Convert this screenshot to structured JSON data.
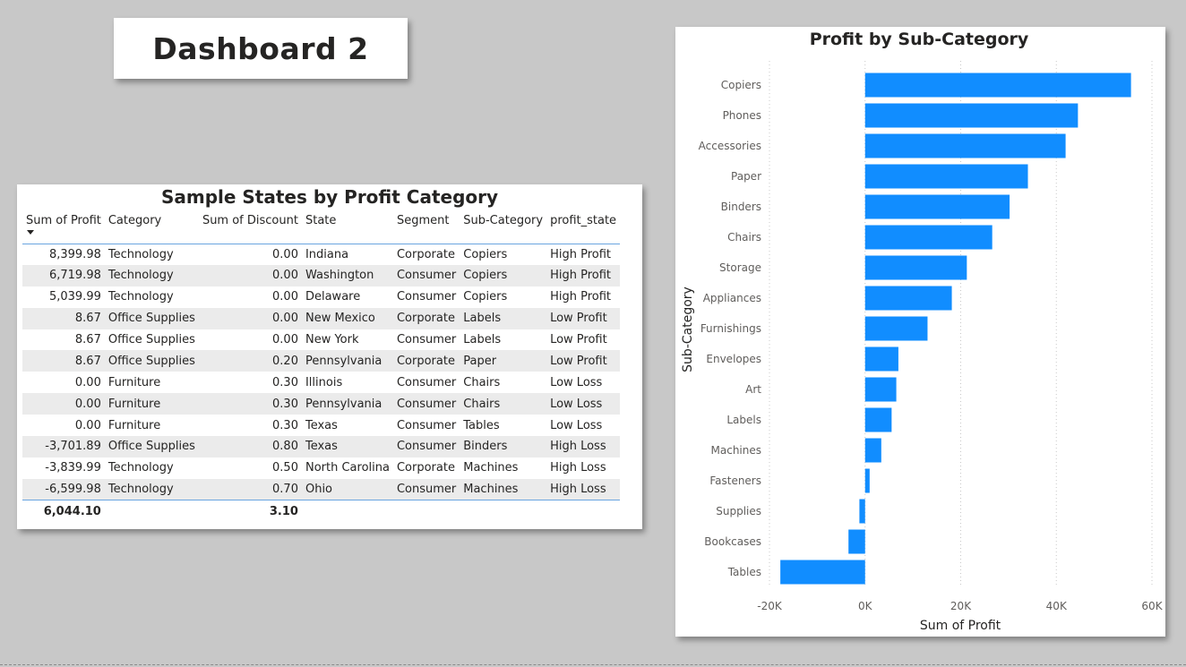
{
  "dashboard": {
    "title": "Dashboard 2"
  },
  "table": {
    "title": "Sample States by Profit Category",
    "columns": [
      "Sum of Profit",
      "Category",
      "Sum of Discount",
      "State",
      "Segment",
      "Sub-Category",
      "profit_state"
    ],
    "rows": [
      [
        "8,399.98",
        "Technology",
        "0.00",
        "Indiana",
        "Corporate",
        "Copiers",
        "High Profit"
      ],
      [
        "6,719.98",
        "Technology",
        "0.00",
        "Washington",
        "Consumer",
        "Copiers",
        "High Profit"
      ],
      [
        "5,039.99",
        "Technology",
        "0.00",
        "Delaware",
        "Consumer",
        "Copiers",
        "High Profit"
      ],
      [
        "8.67",
        "Office Supplies",
        "0.00",
        "New Mexico",
        "Corporate",
        "Labels",
        "Low Profit"
      ],
      [
        "8.67",
        "Office Supplies",
        "0.00",
        "New York",
        "Consumer",
        "Labels",
        "Low Profit"
      ],
      [
        "8.67",
        "Office Supplies",
        "0.20",
        "Pennsylvania",
        "Corporate",
        "Paper",
        "Low Profit"
      ],
      [
        "0.00",
        "Furniture",
        "0.30",
        "Illinois",
        "Consumer",
        "Chairs",
        "Low Loss"
      ],
      [
        "0.00",
        "Furniture",
        "0.30",
        "Pennsylvania",
        "Consumer",
        "Chairs",
        "Low Loss"
      ],
      [
        "0.00",
        "Furniture",
        "0.30",
        "Texas",
        "Consumer",
        "Tables",
        "Low Loss"
      ],
      [
        "-3,701.89",
        "Office Supplies",
        "0.80",
        "Texas",
        "Consumer",
        "Binders",
        "High Loss"
      ],
      [
        "-3,839.99",
        "Technology",
        "0.50",
        "North Carolina",
        "Corporate",
        "Machines",
        "High Loss"
      ],
      [
        "-6,599.98",
        "Technology",
        "0.70",
        "Ohio",
        "Consumer",
        "Machines",
        "High Loss"
      ]
    ],
    "totals": [
      "6,044.10",
      "",
      "3.10",
      "",
      "",
      "",
      ""
    ]
  },
  "chart_data": {
    "type": "bar",
    "orientation": "horizontal",
    "title": "Profit by Sub-Category",
    "xlabel": "Sum of Profit",
    "ylabel": "Sub-Category",
    "categories": [
      "Copiers",
      "Phones",
      "Accessories",
      "Paper",
      "Binders",
      "Chairs",
      "Storage",
      "Appliances",
      "Furnishings",
      "Envelopes",
      "Art",
      "Labels",
      "Machines",
      "Fasteners",
      "Supplies",
      "Bookcases",
      "Tables"
    ],
    "values": [
      55618,
      44516,
      41937,
      34054,
      30222,
      26590,
      21279,
      18138,
      13059,
      6964,
      6528,
      5546,
      3385,
      950,
      -1189,
      -3473,
      -17725
    ],
    "xlim": [
      -20000,
      60000
    ],
    "xticks": [
      -20000,
      0,
      20000,
      40000,
      60000
    ],
    "xtick_labels": [
      "-20K",
      "0K",
      "20K",
      "40K",
      "60K"
    ],
    "bar_color": "#118dff",
    "grid": true
  }
}
